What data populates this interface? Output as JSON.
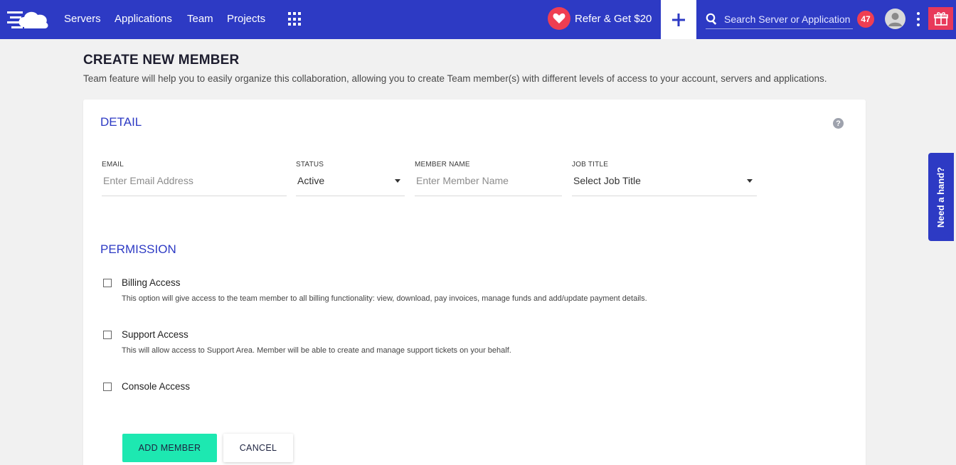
{
  "nav": {
    "logo_icon": "cloud-logo-icon",
    "links": [
      "Servers",
      "Applications",
      "Team",
      "Projects"
    ],
    "apps_icon": "apps-grid-icon",
    "refer_label": "Refer & Get $20",
    "refer_icon": "heart-icon",
    "add_icon": "plus-icon",
    "search_placeholder": "Search Server or Application",
    "notification_count": "47",
    "user_icon": "user-avatar-icon",
    "more_icon": "kebab-menu-icon",
    "gift_icon": "gift-icon"
  },
  "header": {
    "title": "CREATE NEW MEMBER",
    "description": "Team feature will help you to easily organize this collaboration, allowing you to create Team member(s) with different levels of access to your account, servers and applications."
  },
  "detail": {
    "title": "DETAIL",
    "help_icon_glyph": "?",
    "email": {
      "label": "EMAIL",
      "placeholder": "Enter Email Address",
      "value": ""
    },
    "status": {
      "label": "STATUS",
      "value": "Active"
    },
    "member_name": {
      "label": "MEMBER NAME",
      "placeholder": "Enter Member Name",
      "value": ""
    },
    "job_title": {
      "label": "JOB TITLE",
      "value": "Select Job Title"
    }
  },
  "permission": {
    "title": "PERMISSION",
    "items": [
      {
        "title": "Billing Access",
        "description": "This option will give access to the team member to all billing functionality: view, download, pay invoices, manage funds and add/update payment details.",
        "checked": false
      },
      {
        "title": "Support Access",
        "description": "This will allow access to Support Area. Member will be able to create and manage support tickets on your behalf.",
        "checked": false
      },
      {
        "title": "Console Access",
        "description": "",
        "checked": false
      }
    ]
  },
  "actions": {
    "add_label": "ADD MEMBER",
    "cancel_label": "CANCEL"
  },
  "help_tab": {
    "label": "Need a hand?"
  },
  "colors": {
    "nav_bg": "#2d3ac4",
    "accent": "#2d3ac4",
    "primary_button": "#1de8b1",
    "badge_red": "#ef3e52",
    "gift_bg": "#e8395a",
    "page_bg": "#f1f1f1"
  }
}
